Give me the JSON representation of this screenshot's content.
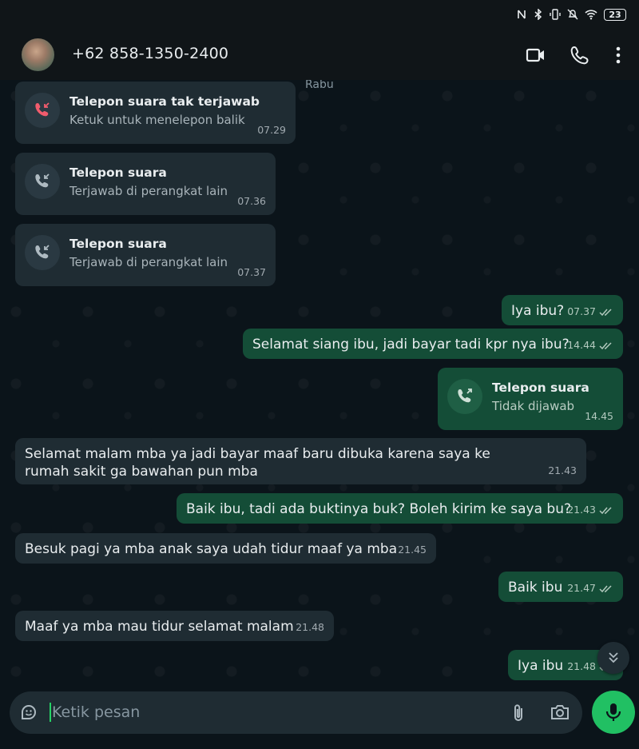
{
  "status_bar": {
    "battery": "23"
  },
  "header": {
    "contact_name": "+62 858-1350-2400",
    "icons": [
      "video-call-icon",
      "voice-call-icon",
      "more-icon"
    ]
  },
  "chat": {
    "date_label": "Rabu",
    "messages": [
      {
        "type": "call",
        "direction": "in",
        "title": "Telepon suara tak terjawab",
        "subtitle": "Ketuk untuk menelepon balik",
        "time": "07.29",
        "missed": true
      },
      {
        "type": "call",
        "direction": "in",
        "title": "Telepon suara",
        "subtitle": "Terjawab di perangkat lain",
        "time": "07.36"
      },
      {
        "type": "call",
        "direction": "in",
        "title": "Telepon suara",
        "subtitle": "Terjawab di perangkat lain",
        "time": "07.37"
      },
      {
        "type": "text",
        "direction": "out",
        "text": "Iya ibu?",
        "time": "07.37"
      },
      {
        "type": "text",
        "direction": "out",
        "text": "Selamat siang ibu, jadi bayar tadi kpr nya ibu?",
        "time": "14.44"
      },
      {
        "type": "call",
        "direction": "out",
        "title": "Telepon suara",
        "subtitle": "Tidak dijawab",
        "time": "14.45"
      },
      {
        "type": "text",
        "direction": "in",
        "text": "Selamat malam mba ya jadi bayar maaf baru dibuka karena saya ke rumah sakit ga bawahan pun mba",
        "time": "21.43"
      },
      {
        "type": "text",
        "direction": "out",
        "text": "Baik ibu, tadi ada buktinya buk? Boleh kirim ke saya bu?",
        "time": "21.43"
      },
      {
        "type": "text",
        "direction": "in",
        "text": "Besuk pagi ya mba anak saya udah tidur maaf ya mba",
        "time": "21.45"
      },
      {
        "type": "text",
        "direction": "out",
        "text": "Baik ibu",
        "time": "21.47"
      },
      {
        "type": "text",
        "direction": "in",
        "text": "Maaf ya mba mau tidur selamat malam",
        "time": "21.48"
      },
      {
        "type": "text",
        "direction": "out",
        "text": "Iya ibu",
        "time": "21.48"
      }
    ]
  },
  "input": {
    "placeholder": "Ketik pesan"
  },
  "colors": {
    "background": "#0b141a",
    "incoming_bubble": "#1f2c33",
    "outgoing_bubble": "#144d37",
    "accent_green": "#21c063",
    "missed_red": "#f15c6d"
  }
}
